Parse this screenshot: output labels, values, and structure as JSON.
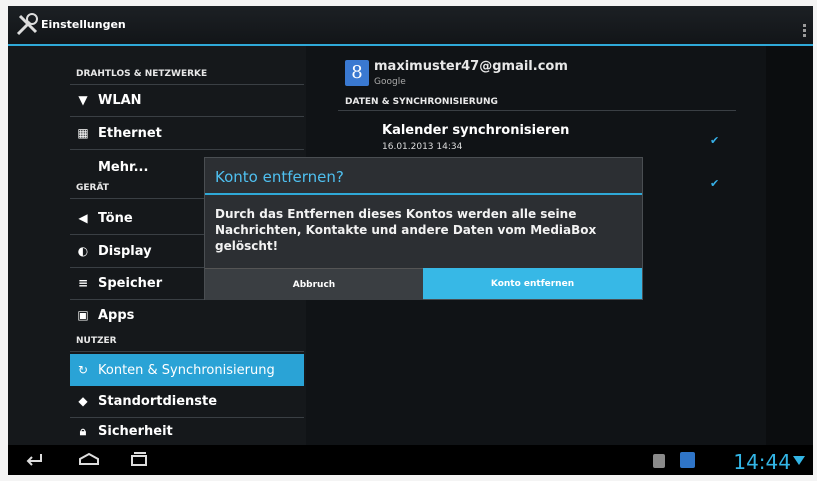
{
  "app": {
    "title": "Einstellungen",
    "icon": "tools-icon"
  },
  "left_sections": [
    {
      "label": "DRAHTLOS & NETZWERKE"
    },
    {
      "label": "GERÄT"
    },
    {
      "label": "NUTZER"
    }
  ],
  "left_items": [
    {
      "label": "WLAN",
      "icon": "wifi-icon"
    },
    {
      "label": "Ethernet",
      "icon": "ethernet-icon"
    },
    {
      "label": "Mehr..."
    },
    {
      "label": "Töne",
      "icon": "speaker-icon"
    },
    {
      "label": "Display",
      "icon": "display-icon"
    },
    {
      "label": "Speicher",
      "icon": "storage-icon"
    },
    {
      "label": "Apps",
      "icon": "apps-icon"
    },
    {
      "label": "Konten & Synchronisierung",
      "icon": "sync-icon",
      "selected": true
    },
    {
      "label": "Standortdienste",
      "icon": "location-icon"
    },
    {
      "label": "Sicherheit",
      "icon": "lock-icon"
    }
  ],
  "account": {
    "email": "maximuster47@gmail.com",
    "type": "Google",
    "icon_letter": "8"
  },
  "sync": {
    "heading": "DATEN & SYNCHRONISIERUNG",
    "items": [
      {
        "title": "Kalender synchronisieren",
        "date": "16.01.2013 14:34",
        "checked": true
      },
      {
        "checked": true
      }
    ]
  },
  "dialog": {
    "title": "Konto entfernen?",
    "message": "Durch das Entfernen dieses Kontos werden alle seine Nachrichten, Kontakte und andere Daten vom MediaBox gelöscht!",
    "cancel_label": "Abbruch",
    "confirm_label": "Konto entfernen"
  },
  "status": {
    "time": "14:44"
  },
  "colors": {
    "accent": "#33b5e5",
    "selected": "#2aa3d6"
  }
}
